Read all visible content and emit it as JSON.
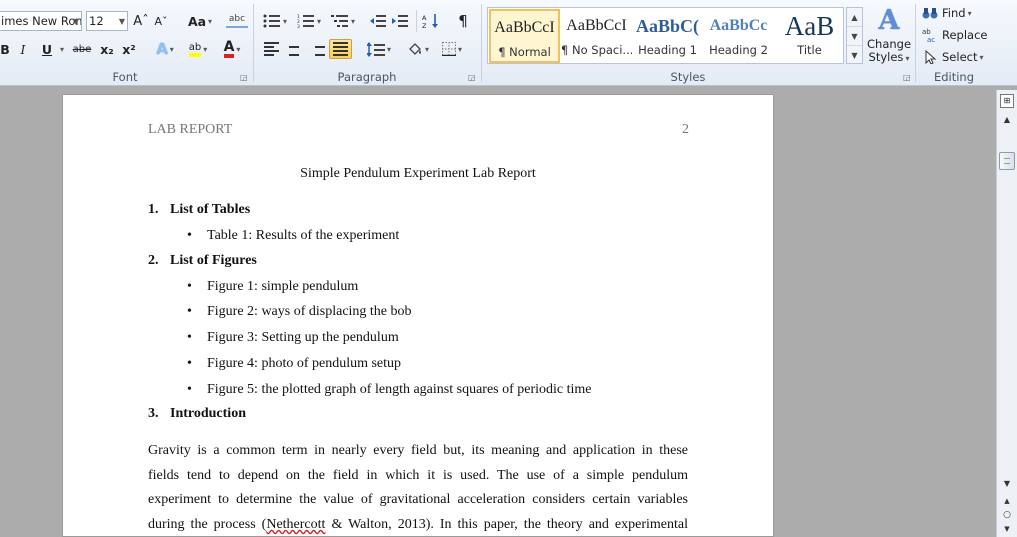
{
  "ribbon": {
    "font": {
      "name": "imes New Rom",
      "size": "12",
      "grow_glyph": "Aˆ",
      "shrink_glyph": "Aˇ",
      "case_glyph": "Aa",
      "clear_glyph": "abc",
      "bold": "B",
      "italic": "I",
      "underline": "U",
      "strike": "abe",
      "subscript": "x₂",
      "superscript": "x²",
      "effects_glyph": "A",
      "highlight_glyph": "ab",
      "fontcolor_glyph": "A",
      "group_label": "Font"
    },
    "paragraph": {
      "pilcrow": "¶",
      "sort_glyph": "↓",
      "group_label": "Paragraph"
    },
    "styles": {
      "items": [
        {
          "preview": "AaBbCcI",
          "name": "¶ Normal"
        },
        {
          "preview": "AaBbCcI",
          "name": "¶ No Spaci..."
        },
        {
          "preview": "AaBbC(",
          "name": "Heading 1"
        },
        {
          "preview": "AaBbCc",
          "name": "Heading 2"
        },
        {
          "preview": "AaB",
          "name": "Title"
        }
      ],
      "change_line1": "Change",
      "change_line2": "Styles",
      "change_glyph": "A",
      "group_label": "Styles"
    },
    "editing": {
      "find": "Find",
      "replace": "Replace",
      "select": "Select",
      "group_label": "Editing"
    }
  },
  "document": {
    "header_left": "LAB REPORT",
    "header_right": "2",
    "title": "Simple Pendulum Experiment Lab Report",
    "sections": [
      {
        "num": "1.",
        "title": "List of Tables",
        "bullets": [
          "Table 1: Results of the experiment"
        ]
      },
      {
        "num": "2.",
        "title": "List of Figures",
        "bullets": [
          "Figure 1: simple pendulum",
          "Figure 2: ways of displacing the bob",
          "Figure 3: Setting up the pendulum",
          "Figure 4: photo of pendulum setup",
          "Figure 5: the plotted graph of length against squares of periodic time"
        ]
      },
      {
        "num": "3.",
        "title": "Introduction",
        "bullets": []
      }
    ],
    "para_lines": [
      "Gravity is a common term in nearly every field but, its meaning and application in these",
      "fields tend to depend on the field in which it is used. The use of a simple pendulum",
      "experiment to determine the value of gravitational acceleration considers certain variables"
    ],
    "para_last_pre": "during the process (",
    "para_last_underlined": "Nethercott",
    "para_last_post": " & Walton, 2013). In this paper, the theory and experimental"
  },
  "colors": {
    "accent": "#1f5fb5",
    "selected_style": "#f1c15f",
    "spellcheck": "#d22222"
  }
}
